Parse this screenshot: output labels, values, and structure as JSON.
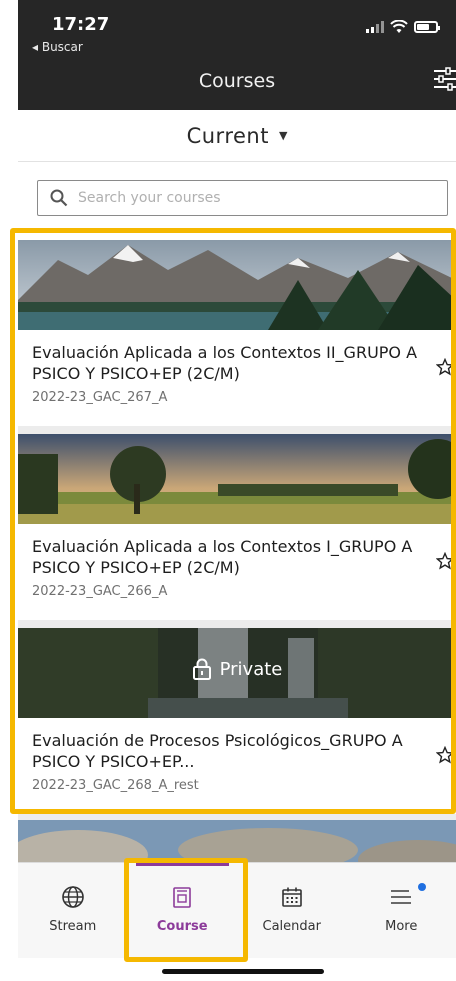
{
  "status": {
    "time": "17:27",
    "back_label": "◂ Buscar"
  },
  "header": {
    "title": "Courses"
  },
  "selector": {
    "label": "Current"
  },
  "search": {
    "placeholder": "Search your courses"
  },
  "courses": [
    {
      "title": "Evaluación Aplicada a los Contextos II_GRUPO A PSICO Y PSICO+EP (2C/M)",
      "code": "2022-23_GAC_267_A",
      "private": false
    },
    {
      "title": "Evaluación Aplicada a los Contextos I_GRUPO A PSICO Y PSICO+EP (2C/M)",
      "code": "2022-23_GAC_266_A",
      "private": false
    },
    {
      "title": "Evaluación de Procesos Psicológicos_GRUPO A PSICO Y PSICO+EP...",
      "code": "2022-23_GAC_268_A_rest",
      "private": true,
      "private_label": "Private"
    }
  ],
  "nav": [
    {
      "label": "Stream",
      "icon": "globe-icon"
    },
    {
      "label": "Course",
      "icon": "course-icon",
      "active": true
    },
    {
      "label": "Calendar",
      "icon": "calendar-icon"
    },
    {
      "label": "More",
      "icon": "menu-icon"
    }
  ],
  "colors": {
    "accent": "#8c3b9a",
    "highlight": "#f5b800",
    "header_bg": "#262626",
    "notification_dot": "#1f6fe0"
  }
}
